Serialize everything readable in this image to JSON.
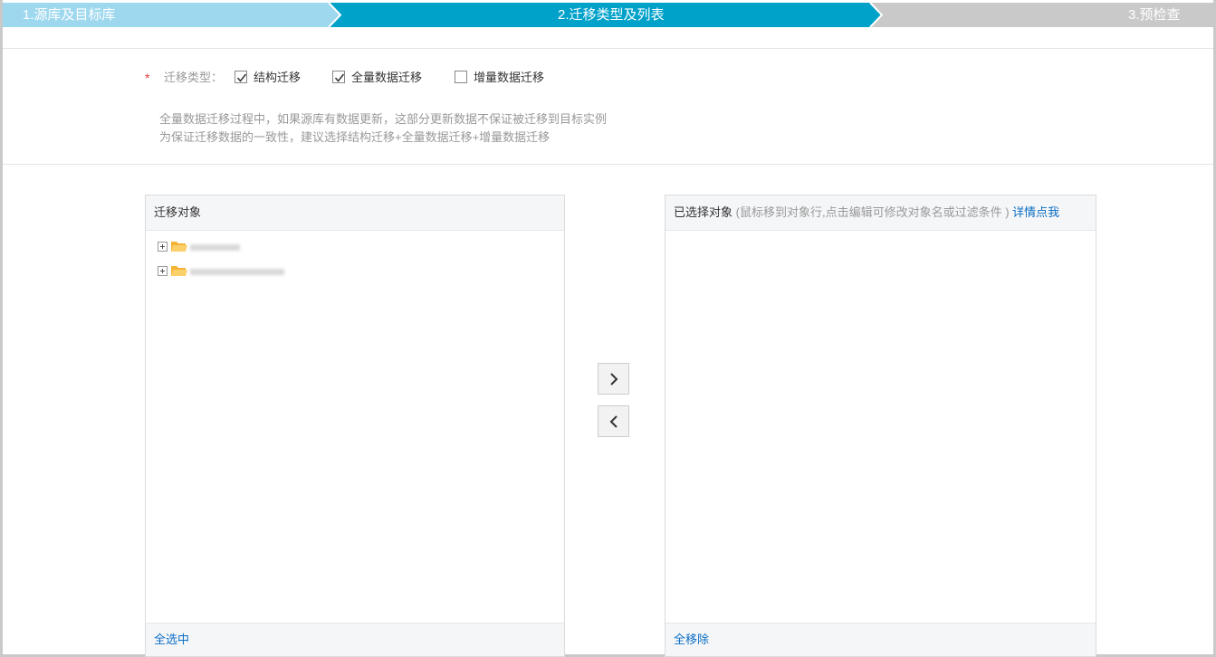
{
  "steps": [
    {
      "label": "1.源库及目标库",
      "state": "done"
    },
    {
      "label": "2.迁移类型及列表",
      "state": "active"
    },
    {
      "label": "3.预检查",
      "state": "pending"
    }
  ],
  "colors": {
    "step_done": "#9ed8ef",
    "step_active": "#00a2ca",
    "step_pending": "#c9c9c9",
    "link": "#0a6ec5",
    "required": "#e4393c"
  },
  "migration_type": {
    "required_mark": "*",
    "label": "迁移类型：",
    "options": [
      {
        "label": "结构迁移",
        "checked": true
      },
      {
        "label": "全量数据迁移",
        "checked": true
      },
      {
        "label": "增量数据迁移",
        "checked": false
      }
    ]
  },
  "note": {
    "line1": "全量数据迁移过程中，如果源库有数据更新，这部分更新数据不保证被迁移到目标实例",
    "line2": "为保证迁移数据的一致性，建议选择结构迁移+全量数据迁移+增量数据迁移"
  },
  "left_panel": {
    "title": "迁移对象",
    "tree": [
      {
        "icon": "folder-icon",
        "name_redacted": true
      },
      {
        "icon": "folder-icon",
        "name_redacted": true
      }
    ],
    "footer_link": "全选中"
  },
  "transfer": {
    "add_icon": "chevron-right-icon",
    "remove_icon": "chevron-left-icon"
  },
  "right_panel": {
    "title": "已选择对象",
    "hint": "(鼠标移到对象行,点击编辑可修改对象名或过滤条件 )",
    "help_link": "详情点我",
    "footer_link": "全移除"
  }
}
